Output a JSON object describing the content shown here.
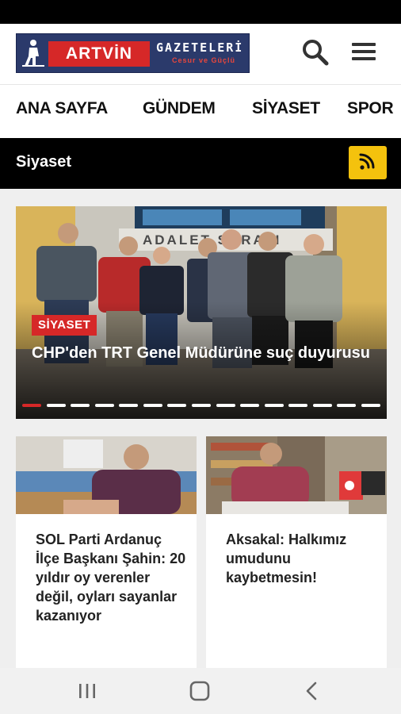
{
  "logo": {
    "brand": "ARTVİN",
    "name": "GAZETELERİ",
    "tagline": "Cesur ve Güçlü"
  },
  "nav": {
    "items": [
      {
        "label": "ANA SAYFA"
      },
      {
        "label": "GÜNDEM"
      },
      {
        "label": "SİYASET"
      },
      {
        "label": "SPOR"
      }
    ]
  },
  "section": {
    "title": "Siyaset"
  },
  "slider": {
    "category": "SİYASET",
    "headline": "CHP'den TRT Genel Müdürüne suç duyurusu",
    "building_sign": "ADALET SARAYI",
    "total_slides": 15,
    "active_slide": 1
  },
  "cards": [
    {
      "title": "SOL Parti Ardanuç İlçe Başkanı Şahin: 20 yıldır oy verenler değil, oyları sayanlar kazanıyor"
    },
    {
      "title": "Aksakal: Halkımız umudunu kaybetmesin!"
    }
  ],
  "colors": {
    "accent_red": "#d62828",
    "rss_yellow": "#f4c20d",
    "logo_navy": "#2b3a6b"
  },
  "icons": {
    "search": "search-icon",
    "menu": "hamburger-menu-icon",
    "rss": "rss-icon",
    "recent_apps": "recent-apps-icon",
    "home": "home-icon",
    "back": "back-icon"
  }
}
